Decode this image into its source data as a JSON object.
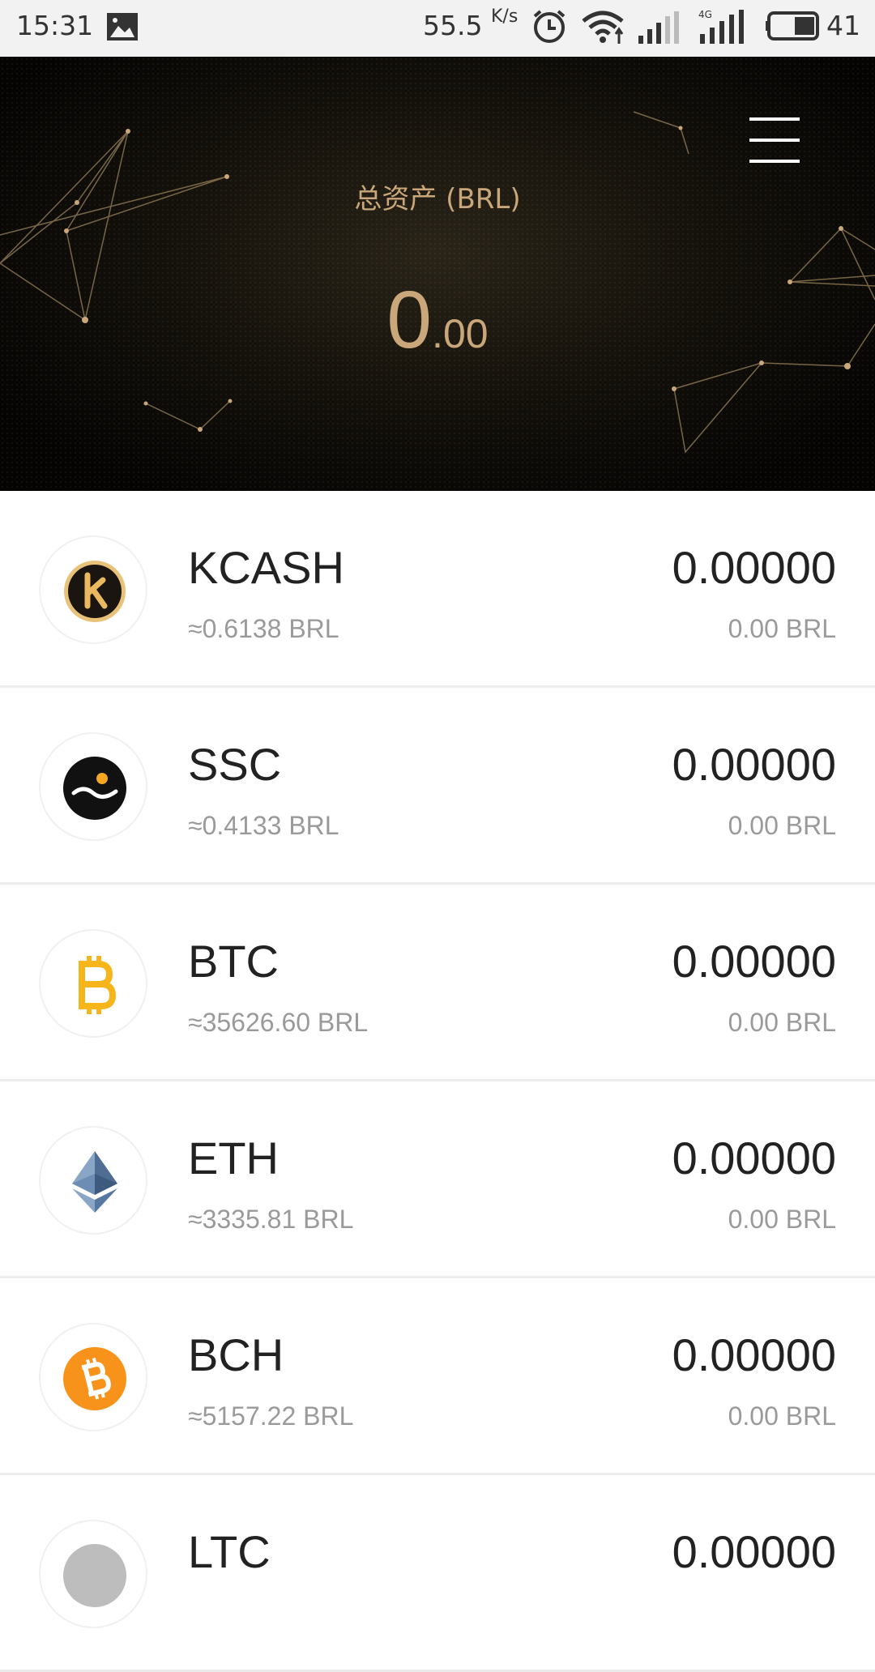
{
  "status_bar": {
    "time": "15:31",
    "network_speed": "55.5",
    "network_speed_unit": "K/s",
    "battery_percent": "41",
    "icons": [
      "gallery-icon",
      "alarm-icon",
      "wifi-icon",
      "signal-icon",
      "4g-signal-icon",
      "battery-icon"
    ]
  },
  "header": {
    "total_label": "总资产 (BRL)",
    "total_integer": "0",
    "total_decimal": ".00",
    "menu_icon": "hamburger-menu-icon",
    "accent_color": "#c9a77a"
  },
  "assets": [
    {
      "symbol": "KCASH",
      "price": "≈0.6138 BRL",
      "balance": "0.00000",
      "value": "0.00 BRL",
      "icon": "kcash-icon"
    },
    {
      "symbol": "SSC",
      "price": "≈0.4133 BRL",
      "balance": "0.00000",
      "value": "0.00 BRL",
      "icon": "ssc-icon"
    },
    {
      "symbol": "BTC",
      "price": "≈35626.60 BRL",
      "balance": "0.00000",
      "value": "0.00 BRL",
      "icon": "btc-icon"
    },
    {
      "symbol": "ETH",
      "price": "≈3335.81 BRL",
      "balance": "0.00000",
      "value": "0.00 BRL",
      "icon": "eth-icon"
    },
    {
      "symbol": "BCH",
      "price": "≈5157.22 BRL",
      "balance": "0.00000",
      "value": "0.00 BRL",
      "icon": "bch-icon"
    },
    {
      "symbol": "LTC",
      "price": "",
      "balance": "0.00000",
      "value": "",
      "icon": "ltc-icon"
    }
  ]
}
